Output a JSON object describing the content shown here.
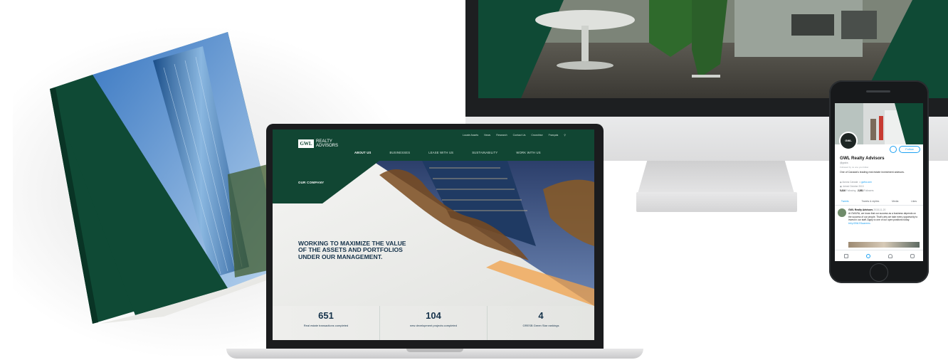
{
  "laptop_site": {
    "logo_mark": "GWL",
    "logo_line1": "REALTY",
    "logo_line2": "ADVISORS",
    "utility_nav": [
      "Locate Assets",
      "News",
      "Research",
      "Contact Us",
      "Crowdrise",
      "Français"
    ],
    "main_nav": [
      "ABOUT US",
      "BUSINESSES",
      "LEASE WITH US",
      "SUSTAINABILITY",
      "WORK WITH US"
    ],
    "hero_eyebrow": "OUR COMPANY",
    "hero_title": "WORKING TO MAXIMIZE THE VALUE OF THE ASSETS AND PORTFOLIOS UNDER OUR MANAGEMENT.",
    "stats": [
      {
        "number": "651",
        "label": "Real estate transactions completed"
      },
      {
        "number": "104",
        "label": "new development projects completed"
      },
      {
        "number": "4",
        "label": "GRESB Green Star rankings"
      }
    ]
  },
  "phone_profile": {
    "avatar_text": "GWL",
    "follow_label": "Follow",
    "name": "GWL Realty Advisors",
    "handle": "@gwlra",
    "followed_by": "Followed by no one you follow",
    "bio": "One of Canada's leading real estate investment advisors.",
    "location": "Across Canada",
    "website": "gwlra.com",
    "joined": "Joined October 2013",
    "following": "5,616",
    "following_label": "Following",
    "followers": "2,581",
    "followers_label": "Followers",
    "tabs": [
      "Tweets",
      "Tweets & replies",
      "Media",
      "Likes"
    ],
    "tweet_author": "GWL Realty Advisors",
    "tweet_date": "2018-11-20",
    "tweet_text": "At GWLRA, we know that our success as a business depends on the success of our people. That's why we take every opportunity to invest in our staff. Apply to one of our open positions today.",
    "tweet_link": "bit.ly/GWLRAcareers"
  },
  "colors": {
    "brand_green": "#114633",
    "title_navy": "#15324a",
    "twitter_blue": "#1da1f2"
  }
}
